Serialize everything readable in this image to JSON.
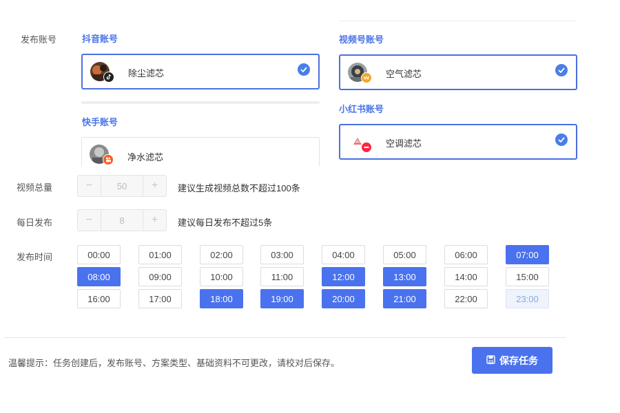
{
  "labels": {
    "publish_account": "发布账号",
    "video_total": "视频总量",
    "daily_publish": "每日发布",
    "publish_time": "发布时间"
  },
  "platforms": {
    "douyin": {
      "title": "抖音账号",
      "account": "除尘滤芯",
      "selected": true
    },
    "kuaishou": {
      "title": "快手账号",
      "account": "净水滤芯",
      "selected": false
    },
    "shipinhao": {
      "title": "视频号账号",
      "account": "空气滤芯",
      "selected": true
    },
    "xiaohongshu": {
      "title": "小红书账号",
      "account": "空调滤芯",
      "selected": true
    }
  },
  "video_total": {
    "minus": "−",
    "value": "50",
    "plus": "+",
    "hint": "建议生成视频总数不超过100条"
  },
  "daily_publish": {
    "minus": "−",
    "value": "8",
    "plus": "+",
    "hint": "建议每日发布不超过5条"
  },
  "times": [
    {
      "label": "00:00",
      "state": "off"
    },
    {
      "label": "01:00",
      "state": "off"
    },
    {
      "label": "02:00",
      "state": "off"
    },
    {
      "label": "03:00",
      "state": "off"
    },
    {
      "label": "04:00",
      "state": "off"
    },
    {
      "label": "05:00",
      "state": "off"
    },
    {
      "label": "06:00",
      "state": "off"
    },
    {
      "label": "07:00",
      "state": "on"
    },
    {
      "label": "08:00",
      "state": "on"
    },
    {
      "label": "09:00",
      "state": "off"
    },
    {
      "label": "10:00",
      "state": "off"
    },
    {
      "label": "11:00",
      "state": "off"
    },
    {
      "label": "12:00",
      "state": "on"
    },
    {
      "label": "13:00",
      "state": "on"
    },
    {
      "label": "14:00",
      "state": "off"
    },
    {
      "label": "15:00",
      "state": "off"
    },
    {
      "label": "16:00",
      "state": "off"
    },
    {
      "label": "17:00",
      "state": "off"
    },
    {
      "label": "18:00",
      "state": "on"
    },
    {
      "label": "19:00",
      "state": "on"
    },
    {
      "label": "20:00",
      "state": "on"
    },
    {
      "label": "21:00",
      "state": "on"
    },
    {
      "label": "22:00",
      "state": "off"
    },
    {
      "label": "23:00",
      "state": "disabled"
    }
  ],
  "footer": {
    "tip": "温馨提示：任务创建后，发布账号、方案类型、基础资料不可更改，请校对后保存。",
    "save_label": "保存任务"
  },
  "colors": {
    "accent": "#4a72ee",
    "title_blue": "#4a74e8",
    "check": "#4a7ee8"
  },
  "icons": {
    "check": "check-circle-icon",
    "save": "save-disk-icon",
    "douyin_badge": "douyin-logo-icon",
    "kuaishou_badge": "kuaishou-logo-icon",
    "shipinhao_badge": "shipinhao-logo-icon",
    "xiaohongshu_badge": "xiaohongshu-logo-icon"
  }
}
